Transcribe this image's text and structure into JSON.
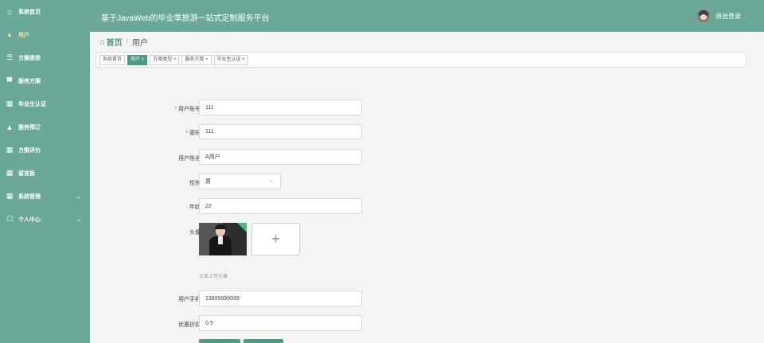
{
  "app": {
    "title": "基于JavaWeb的毕业季旅游一站式定制服务平台",
    "logout": "退出登录"
  },
  "sidebar": {
    "items": [
      {
        "icon": "house-icon",
        "glyph": "⌂",
        "label": "系统首页"
      },
      {
        "icon": "location-pin-icon",
        "glyph": "♦",
        "label": "用户"
      },
      {
        "icon": "menu-lines-icon",
        "glyph": "☰",
        "label": "方案类型"
      },
      {
        "icon": "monitor-icon",
        "glyph": "▀",
        "label": "服务方案"
      },
      {
        "icon": "grid-icon",
        "glyph": "▦",
        "label": "毕业生认证"
      },
      {
        "icon": "thumbs-up-icon",
        "glyph": "▲",
        "label": "服务预订"
      },
      {
        "icon": "grid-icon",
        "glyph": "▦",
        "label": "方案评价"
      },
      {
        "icon": "grid-icon",
        "glyph": "▦",
        "label": "留言板"
      },
      {
        "icon": "grid-icon",
        "glyph": "▦",
        "label": "系统管理"
      },
      {
        "icon": "calendar-icon",
        "glyph": "☐",
        "label": "个人中心"
      }
    ],
    "active_index": 1
  },
  "breadcrumb": {
    "home": "首页",
    "sep": "/",
    "current": "用户"
  },
  "tags": [
    "系统首页",
    "用户 ×",
    "方案类型 ×",
    "服务方案 ×",
    "毕业生认证 ×"
  ],
  "form": {
    "account_label": "用户账号",
    "account_value": "111",
    "password_label": "密码",
    "password_value": "111",
    "name_label": "用户姓名",
    "name_value": "A用户",
    "gender_label": "性别",
    "gender_value": "男",
    "age_label": "年龄",
    "age_value": "22",
    "avatar_label": "头像",
    "upload_plus": "+",
    "upload_hint": "点击上传头像",
    "phone_label": "用户手机",
    "phone_value": "13899999999",
    "discount_label": "优惠折扣",
    "discount_value": "0.5"
  },
  "colors": {
    "primary": "#6aa99a",
    "accent": "#4d9b86",
    "required": "#e15656"
  }
}
